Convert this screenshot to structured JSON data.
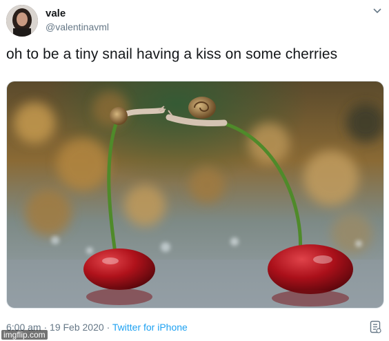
{
  "tweet": {
    "display_name": "vale",
    "handle": "@valentinavml",
    "text": "oh to be a tiny snail having a kiss on some cherries",
    "time": "6:00 am",
    "date": "19 Feb 2020",
    "separator": "·",
    "source": "Twitter for iPhone"
  },
  "icons": {
    "menu": "chevron-down-icon",
    "analytics": "analytics-icon",
    "avatar": "avatar"
  },
  "watermark": "imgflip.com",
  "colors": {
    "link": "#1da1f2",
    "secondary_text": "#657786",
    "cherry": "#b0121b",
    "stem": "#4f8a2a"
  }
}
